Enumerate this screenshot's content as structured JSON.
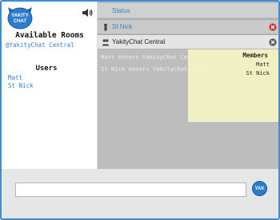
{
  "app": {
    "logo_text": "YAKITY CHAT"
  },
  "sidebar": {
    "available_rooms_heading": "Available Rooms",
    "rooms": [
      {
        "label": "@YakityChat Central"
      }
    ],
    "users_heading": "Users",
    "users": [
      {
        "label": "Matt"
      },
      {
        "label": "St Nick"
      }
    ],
    "sound_icon": "speaker-icon"
  },
  "tabs": {
    "status": {
      "label": "Status"
    },
    "private": {
      "label": "St Nick",
      "icon": "person-icon",
      "close_icon": "close-red-icon"
    },
    "room": {
      "label": "YakityChat Central",
      "icon": "group-icon",
      "close_icon": "close-gray-icon"
    }
  },
  "chat": {
    "messages": [
      {
        "text": "Matt enters YakityChat Central."
      },
      {
        "text": "St Nick enters YakityChat Central."
      }
    ]
  },
  "members": {
    "heading": "Members",
    "list": [
      {
        "label": "Matt"
      },
      {
        "label": "St Nick"
      }
    ]
  },
  "input": {
    "value": "",
    "placeholder": ""
  },
  "send_button": {
    "label": "YAK"
  },
  "colors": {
    "accent": "#3b7fd0",
    "border": "#3b8fd6",
    "members_bg": "#f3f2c4",
    "close_red": "#d43030"
  }
}
